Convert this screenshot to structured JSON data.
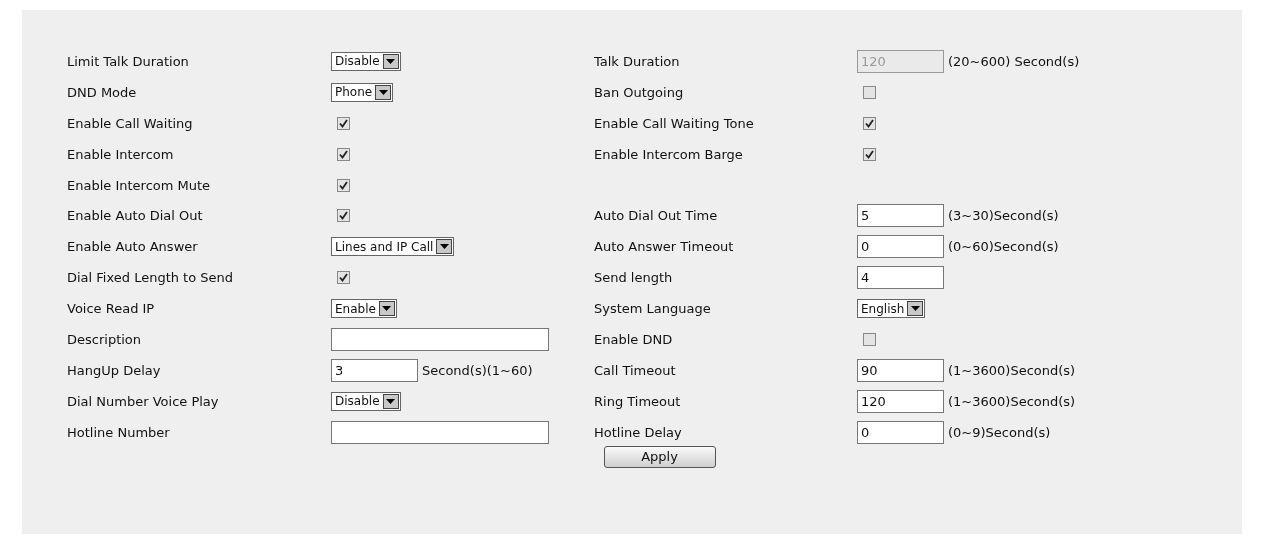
{
  "settings": [
    {
      "left": {
        "label": "Limit Talk Duration",
        "kind": "select",
        "value": "Disable"
      },
      "right": {
        "label": "Talk Duration",
        "kind": "input",
        "value": "120",
        "disabled": true,
        "unit": "(20~600) Second(s)"
      }
    },
    {
      "left": {
        "label": "DND Mode",
        "kind": "select",
        "value": "Phone"
      },
      "right": {
        "label": "Ban Outgoing",
        "kind": "checkbox",
        "checked": false
      }
    },
    {
      "left": {
        "label": "Enable Call Waiting",
        "kind": "checkbox",
        "checked": true
      },
      "right": {
        "label": "Enable Call Waiting Tone",
        "kind": "checkbox",
        "checked": true
      }
    },
    {
      "left": {
        "label": "Enable Intercom",
        "kind": "checkbox",
        "checked": true
      },
      "right": {
        "label": "Enable Intercom Barge",
        "kind": "checkbox",
        "checked": true
      }
    },
    {
      "left": {
        "label": "Enable Intercom Mute",
        "kind": "checkbox",
        "checked": true
      }
    },
    {
      "left": {
        "label": "Enable Auto Dial Out",
        "kind": "checkbox",
        "checked": true
      },
      "right": {
        "label": "Auto Dial Out Time",
        "kind": "input",
        "value": "5",
        "unit": "(3~30)Second(s)"
      }
    },
    {
      "left": {
        "label": "Enable Auto Answer",
        "kind": "select",
        "value": "Lines and IP Call"
      },
      "right": {
        "label": "Auto Answer Timeout",
        "kind": "input",
        "value": "0",
        "unit": "(0~60)Second(s)"
      }
    },
    {
      "left": {
        "label": "Dial Fixed Length to Send",
        "kind": "checkbox",
        "checked": true
      },
      "right": {
        "label": "Send length",
        "kind": "input",
        "value": "4"
      }
    },
    {
      "left": {
        "label": "Voice Read IP",
        "kind": "select",
        "value": "Enable"
      },
      "right": {
        "label": "System Language",
        "kind": "select",
        "value": "English"
      }
    },
    {
      "left": {
        "label": "Description",
        "kind": "input"
      },
      "right": {
        "label": "Enable DND",
        "kind": "checkbox",
        "checked": false
      }
    },
    {
      "left": {
        "label": "HangUp Delay",
        "kind": "input",
        "value": "3",
        "unit": "Second(s)(1~60)"
      },
      "right": {
        "label": "Call Timeout",
        "kind": "input",
        "value": "90",
        "unit": "(1~3600)Second(s)"
      }
    },
    {
      "left": {
        "label": "Dial Number Voice Play",
        "kind": "select",
        "value": "Disable"
      },
      "right": {
        "label": "Ring Timeout",
        "kind": "input",
        "value": "120",
        "unit": "(1~3600)Second(s)"
      }
    },
    {
      "left": {
        "label": "Hotline Number",
        "kind": "input"
      },
      "right": {
        "label": "Hotline Delay",
        "kind": "input",
        "value": "0",
        "unit": "(0~9)Second(s)"
      }
    }
  ],
  "apply_button": "Apply"
}
